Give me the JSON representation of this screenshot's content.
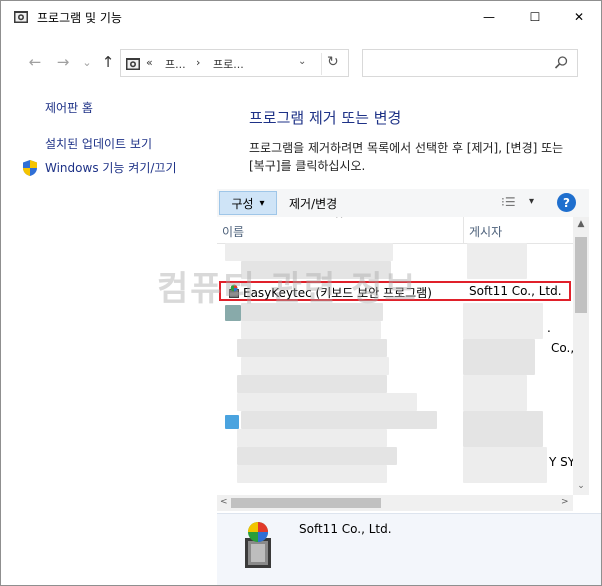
{
  "window": {
    "title": "프로그램 및 기능",
    "minimize_symbol": "—",
    "maximize_symbol": "☐",
    "close_symbol": "✕"
  },
  "nav": {
    "back_symbol": "←",
    "forward_symbol": "→",
    "recent_symbol": "⌄",
    "up_symbol": "↑",
    "address_overflow": "«",
    "breadcrumb": [
      "프...",
      "프로..."
    ],
    "breadcrumb_sep": "›",
    "address_dropdown": "⌄",
    "refresh_symbol": "↻",
    "search_placeholder": ""
  },
  "sidebar": {
    "home": "제어판 홈",
    "view_updates": "설치된 업데이트 보기",
    "windows_features": "Windows 기능 켜기/끄기"
  },
  "main": {
    "heading": "프로그램 제거 또는 변경",
    "description": "프로그램을 제거하려면 목록에서 선택한 후 [제거], [변경] 또는 [복구]를 클릭하십시오."
  },
  "toolbar": {
    "organize": "구성",
    "organize_dropdown": "▾",
    "uninstall_change": "제거/변경",
    "views_symbol": "⁝☰",
    "views_dropdown": "▾",
    "help": "?"
  },
  "list": {
    "columns": [
      "이름",
      "게시자"
    ],
    "sort_indicator": "^",
    "selected_row": {
      "name": "EasyKeytec (키보드 보안 프로그램)",
      "publisher": "Soft11 Co., Ltd."
    },
    "partial_publisher_texts": [
      ".",
      "Co.,",
      "Y SY"
    ],
    "scroll_up": "▲",
    "scroll_down": "⌄",
    "scroll_left": "<",
    "scroll_right": ">"
  },
  "details": {
    "publisher": "Soft11 Co., Ltd."
  },
  "watermark": "컴퓨터 관련 정보"
}
